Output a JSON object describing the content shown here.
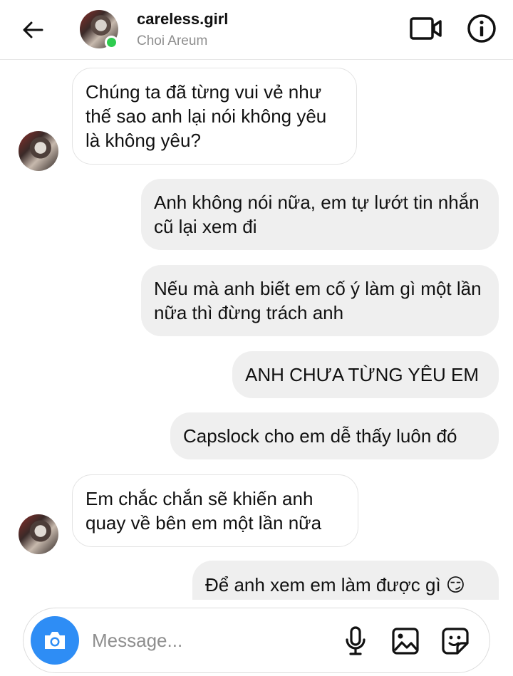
{
  "header": {
    "username": "careless.girl",
    "display_name": "Choi Areum"
  },
  "messages": [
    {
      "side": "in",
      "text": "Chúng ta đã từng vui vẻ như thế sao anh lại nói không yêu là không yêu?"
    },
    {
      "side": "out",
      "text": "Anh không nói nữa, em tự lướt tin nhắn cũ lại xem đi"
    },
    {
      "side": "out",
      "text": "Nếu mà anh biết em cố ý làm gì một lần nữa thì đừng trách anh"
    },
    {
      "side": "out",
      "text": "ANH CHƯA TỪNG YÊU EM"
    },
    {
      "side": "out",
      "text": "Capslock cho em dễ thấy luôn đó"
    },
    {
      "side": "in",
      "text": "Em chắc chắn sẽ khiến anh quay về bên em một lần nữa"
    },
    {
      "side": "out",
      "text": "Để anh xem em làm được gì 😏"
    }
  ],
  "composer": {
    "placeholder": "Message..."
  },
  "colors": {
    "accent": "#2e8df5",
    "online": "#2ecc4f",
    "outgoing_bubble": "#efefef"
  }
}
